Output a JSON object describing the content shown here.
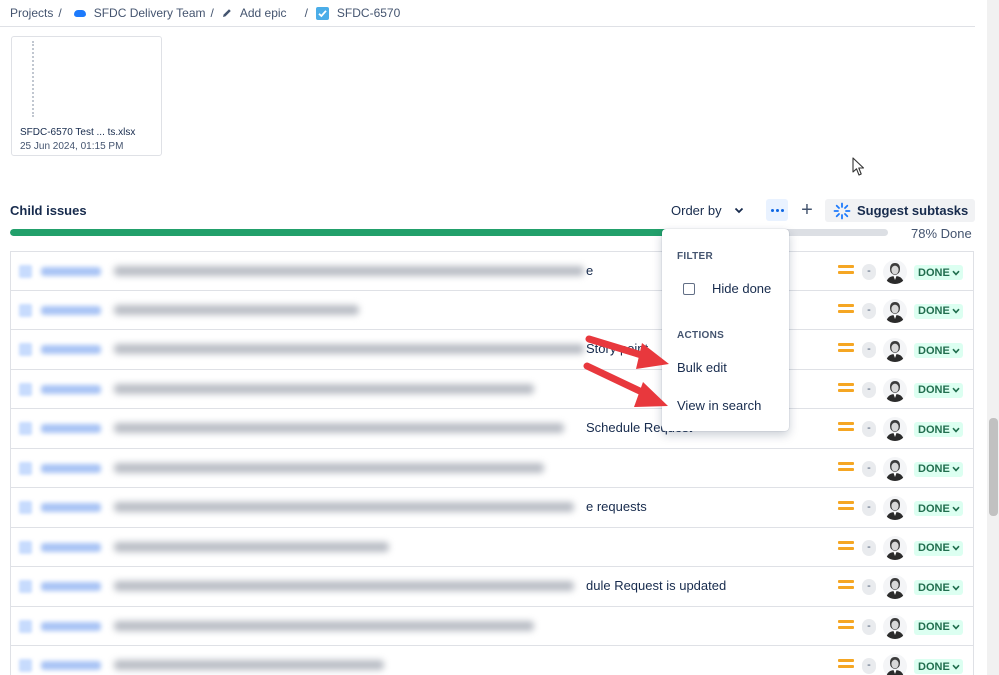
{
  "breadcrumb": {
    "items": [
      {
        "label": "Projects",
        "icon": null
      },
      {
        "label": "SFDC Delivery Team",
        "icon": "cloud-icon"
      },
      {
        "label": "Add epic",
        "icon": "pencil-icon"
      },
      {
        "label": "SFDC-6570",
        "icon": "checkbox-icon"
      }
    ]
  },
  "attachment": {
    "name": "SFDC-6570 Test ... ts.xlsx",
    "date": "25 Jun 2024, 01:15 PM"
  },
  "child_issues": {
    "title": "Child issues",
    "order_by": "Order by",
    "add_label": "+",
    "suggest_label": "Suggest subtasks",
    "progress_percent": 78,
    "progress_label": "78% Done"
  },
  "menu": {
    "filter_heading": "FILTER",
    "hide_done": "Hide done",
    "actions_heading": "ACTIONS",
    "bulk_edit": "Bulk edit",
    "view_in_search": "View in search"
  },
  "rows": [
    {
      "visible_text": "e",
      "status": "DONE"
    },
    {
      "visible_text": "",
      "status": "DONE"
    },
    {
      "visible_text": "Story point",
      "status": "DONE"
    },
    {
      "visible_text": "",
      "status": "DONE"
    },
    {
      "visible_text": "Schedule Request",
      "status": "DONE"
    },
    {
      "visible_text": "",
      "status": "DONE"
    },
    {
      "visible_text": "e requests",
      "status": "DONE"
    },
    {
      "visible_text": "",
      "status": "DONE"
    },
    {
      "visible_text": "dule Request is updated",
      "status": "DONE"
    },
    {
      "visible_text": "",
      "status": "DONE"
    },
    {
      "visible_text": "",
      "status": "DONE"
    }
  ],
  "colors": {
    "progress": "#22a06b",
    "link": "#0c66e4",
    "priority": "#f5a623",
    "done_bg": "#dcfff1",
    "done_text": "#216e4e",
    "annotation_arrow": "#e8383d"
  }
}
